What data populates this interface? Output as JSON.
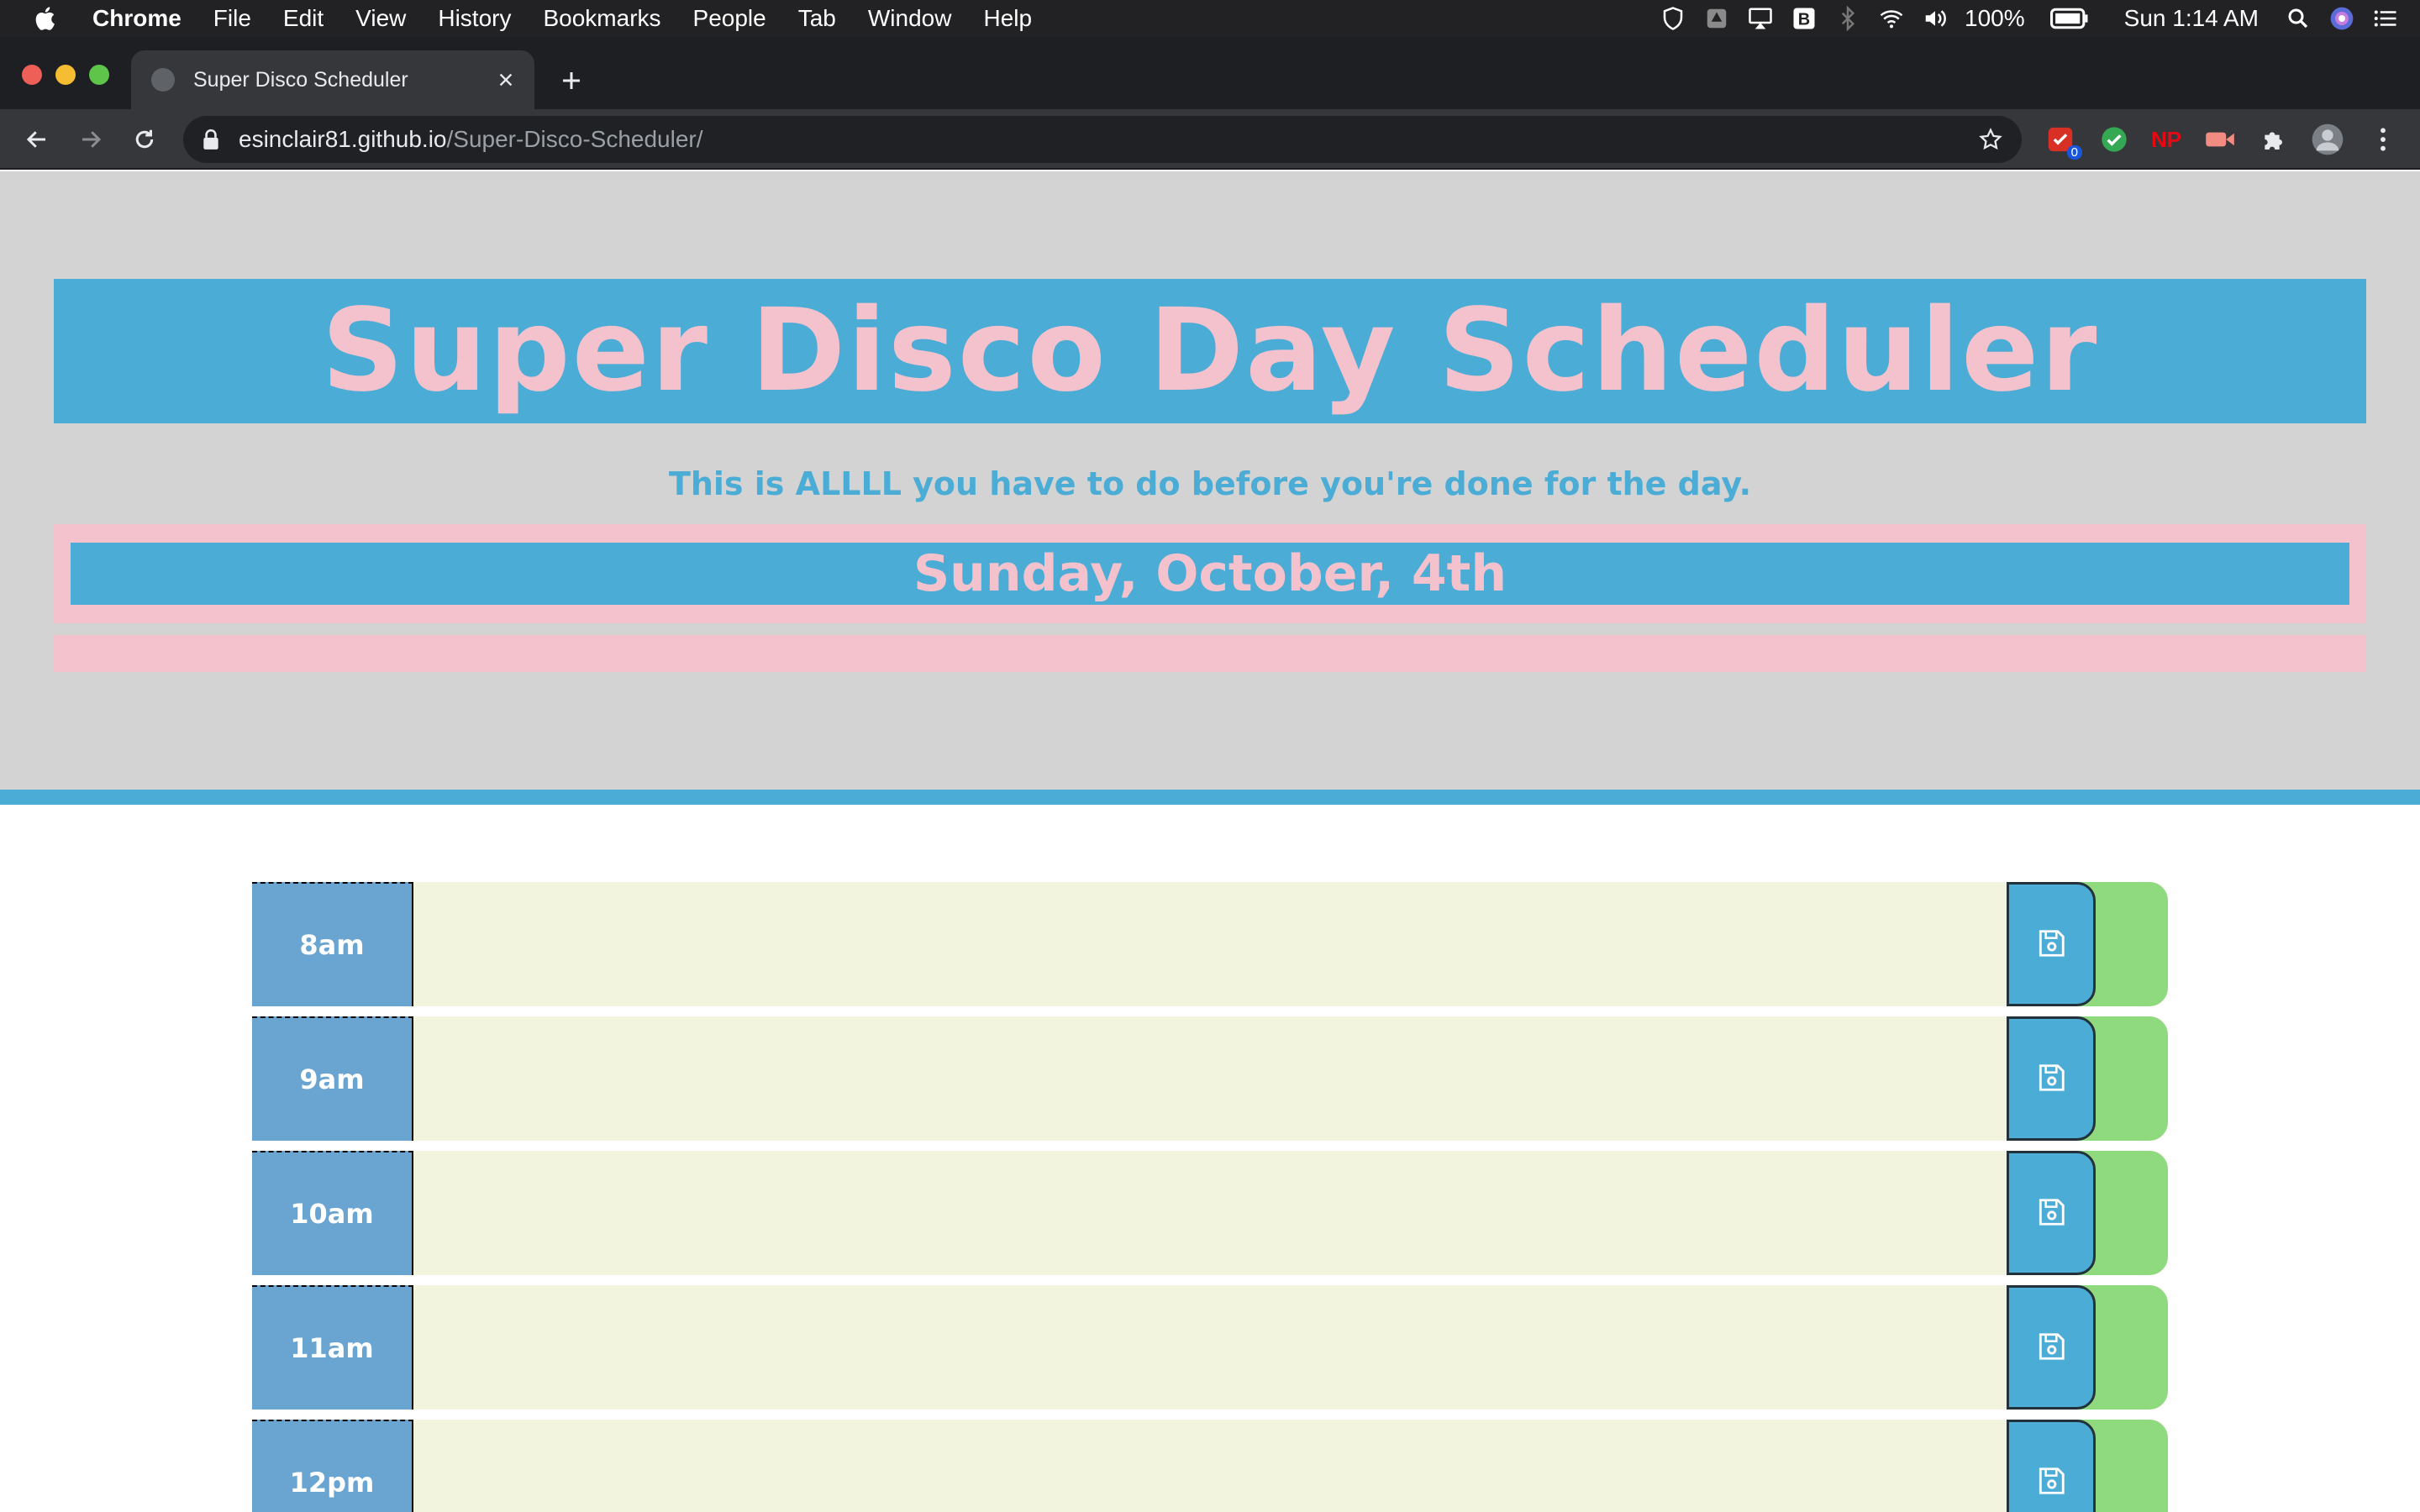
{
  "menubar": {
    "app_name": "Chrome",
    "items": [
      "File",
      "Edit",
      "View",
      "History",
      "Bookmarks",
      "People",
      "Tab",
      "Window",
      "Help"
    ],
    "battery": "100%",
    "clock": "Sun 1:14 AM"
  },
  "browser": {
    "tab_title": "Super Disco Scheduler",
    "url_host": "esinclair81.github.io",
    "url_path": "/Super-Disco-Scheduler/",
    "extension_badge": "0",
    "np_label": "NP"
  },
  "header": {
    "title": "Super Disco Day Scheduler",
    "lead": "This is ALLLL you have to do before you're done for the day.",
    "current_day": "Sunday, October, 4th"
  },
  "colors": {
    "accent_blue": "#4bacd6",
    "accent_pink": "#f4c2cd",
    "future_green": "#8fda7f",
    "hour_blue": "#6aa4d1",
    "textarea_bg": "#f3f4de"
  },
  "time_blocks": [
    {
      "hour": "8am",
      "text": ""
    },
    {
      "hour": "9am",
      "text": ""
    },
    {
      "hour": "10am",
      "text": ""
    },
    {
      "hour": "11am",
      "text": ""
    },
    {
      "hour": "12pm",
      "text": ""
    }
  ]
}
